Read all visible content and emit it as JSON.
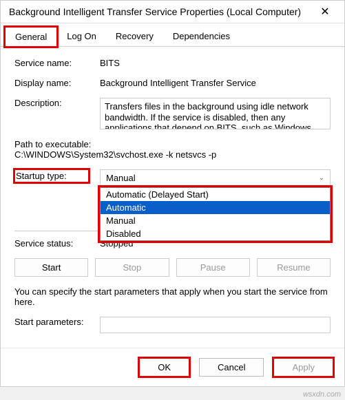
{
  "titlebar": {
    "title": "Background Intelligent Transfer Service Properties (Local Computer)"
  },
  "tabs": {
    "general": "General",
    "logon": "Log On",
    "recovery": "Recovery",
    "dependencies": "Dependencies"
  },
  "labels": {
    "service_name": "Service name:",
    "display_name": "Display name:",
    "description": "Description:",
    "path_label": "Path to executable:",
    "startup_type": "Startup type:",
    "service_status": "Service status:",
    "start_params": "Start parameters:"
  },
  "values": {
    "service_name": "BITS",
    "display_name": "Background Intelligent Transfer Service",
    "description": "Transfers files in the background using idle network bandwidth. If the service is disabled, then any applications that depend on BITS, such as Windows",
    "path": "C:\\WINDOWS\\System32\\svchost.exe -k netsvcs -p",
    "startup_selected": "Manual",
    "service_status": "Stopped",
    "start_params": ""
  },
  "startup_options": {
    "o0": "Automatic (Delayed Start)",
    "o1": "Automatic",
    "o2": "Manual",
    "o3": "Disabled"
  },
  "buttons": {
    "start": "Start",
    "stop": "Stop",
    "pause": "Pause",
    "resume": "Resume",
    "ok": "OK",
    "cancel": "Cancel",
    "apply": "Apply"
  },
  "hint": "You can specify the start parameters that apply when you start the service from here.",
  "watermark": "wsxdn.com"
}
